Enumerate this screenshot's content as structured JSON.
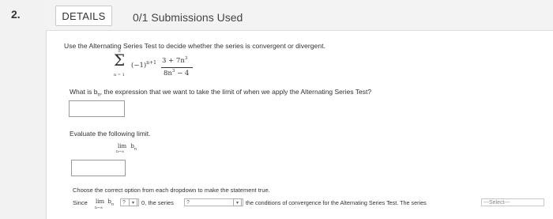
{
  "question": {
    "number": "2.",
    "details_label": "DETAILS",
    "submissions": "0/1 Submissions Used"
  },
  "prompt": "Use the Alternating Series Test to decide whether the series is convergent or divergent.",
  "series": {
    "sigma": "Σ",
    "upper": "∞",
    "lower": "n = 1",
    "factor": "(−1)",
    "exponent": "n+1",
    "numerator": "3 + 7n",
    "num_exp": "3",
    "denominator": "8n",
    "den_exp": "3",
    "den_tail": " − 4"
  },
  "question_bn": {
    "before": "What is b",
    "sub": "n",
    "after": ", the expression that we want to take the limit of when we apply the Alternating Series Test?"
  },
  "evaluate_label": "Evaluate the following limit.",
  "limit": {
    "lim": "lim",
    "under": "n→∞",
    "b": "b",
    "sub": "n"
  },
  "dropdown_instruction": "Choose the correct option from each dropdown to make the statement true.",
  "statement": {
    "since": "Since",
    "lim": "lim",
    "under": "n→∞",
    "b": "b",
    "sub": "n",
    "dropdown1": "?",
    "zero_text": "0, the series",
    "dropdown2": "?",
    "conditions_text": "the conditions of convergence for the Alternating Series Test. The series",
    "dropdown3": "---Select---"
  }
}
